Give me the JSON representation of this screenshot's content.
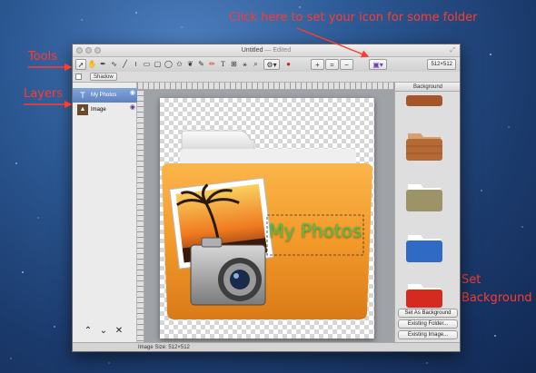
{
  "annotations": {
    "icon_hint": "Click here to set your icon for some folder",
    "tools": "Tools",
    "layers": "Layers",
    "set_bg_line1": "Set",
    "set_bg_line2": "Background",
    "color": "#ff3b2f"
  },
  "window": {
    "title": "Untitled",
    "edited": "— Edited"
  },
  "toolbar": {
    "tools": [
      "pointer-icon",
      "grab-icon",
      "pen-icon",
      "curve-icon",
      "line-icon",
      "rectangle-icon",
      "rounded-rect-icon",
      "ellipse-icon",
      "star-icon",
      "butterfly-icon",
      "brush-icon",
      "pencil-icon",
      "text-icon",
      "crop-icon",
      "magic-wand-icon",
      "zoom-icon"
    ],
    "size_select": "512×512"
  },
  "subbar": {
    "shadow_label": "Shadow"
  },
  "layers": {
    "items": [
      {
        "name": "My Photos",
        "selected": true
      },
      {
        "name": "Image",
        "selected": false
      }
    ]
  },
  "canvas": {
    "label_text": "My Photos"
  },
  "background_panel": {
    "header": "Background",
    "buttons": {
      "set_as_background": "Set As Background",
      "existing_folder": "Existing Folder...",
      "existing_image": "Existing Image..."
    }
  },
  "status": {
    "image_size": "Image Size: 512×512"
  }
}
